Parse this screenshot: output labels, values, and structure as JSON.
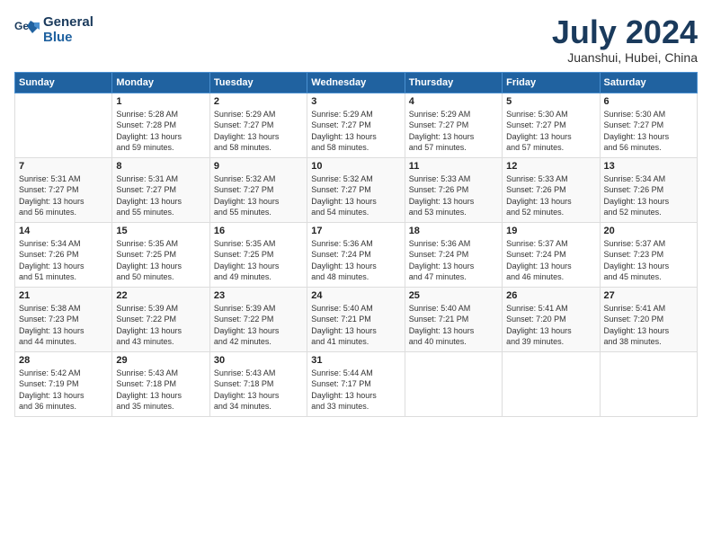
{
  "logo": {
    "line1": "General",
    "line2": "Blue"
  },
  "title": "July 2024",
  "subtitle": "Juanshui, Hubei, China",
  "headers": [
    "Sunday",
    "Monday",
    "Tuesday",
    "Wednesday",
    "Thursday",
    "Friday",
    "Saturday"
  ],
  "weeks": [
    [
      {
        "day": "",
        "sunrise": "",
        "sunset": "",
        "daylight": ""
      },
      {
        "day": "1",
        "sunrise": "5:28 AM",
        "sunset": "7:28 PM",
        "daylight": "13 hours and 59 minutes."
      },
      {
        "day": "2",
        "sunrise": "5:29 AM",
        "sunset": "7:27 PM",
        "daylight": "13 hours and 58 minutes."
      },
      {
        "day": "3",
        "sunrise": "5:29 AM",
        "sunset": "7:27 PM",
        "daylight": "13 hours and 58 minutes."
      },
      {
        "day": "4",
        "sunrise": "5:29 AM",
        "sunset": "7:27 PM",
        "daylight": "13 hours and 57 minutes."
      },
      {
        "day": "5",
        "sunrise": "5:30 AM",
        "sunset": "7:27 PM",
        "daylight": "13 hours and 57 minutes."
      },
      {
        "day": "6",
        "sunrise": "5:30 AM",
        "sunset": "7:27 PM",
        "daylight": "13 hours and 56 minutes."
      }
    ],
    [
      {
        "day": "7",
        "sunrise": "5:31 AM",
        "sunset": "7:27 PM",
        "daylight": "13 hours and 56 minutes."
      },
      {
        "day": "8",
        "sunrise": "5:31 AM",
        "sunset": "7:27 PM",
        "daylight": "13 hours and 55 minutes."
      },
      {
        "day": "9",
        "sunrise": "5:32 AM",
        "sunset": "7:27 PM",
        "daylight": "13 hours and 55 minutes."
      },
      {
        "day": "10",
        "sunrise": "5:32 AM",
        "sunset": "7:27 PM",
        "daylight": "13 hours and 54 minutes."
      },
      {
        "day": "11",
        "sunrise": "5:33 AM",
        "sunset": "7:26 PM",
        "daylight": "13 hours and 53 minutes."
      },
      {
        "day": "12",
        "sunrise": "5:33 AM",
        "sunset": "7:26 PM",
        "daylight": "13 hours and 52 minutes."
      },
      {
        "day": "13",
        "sunrise": "5:34 AM",
        "sunset": "7:26 PM",
        "daylight": "13 hours and 52 minutes."
      }
    ],
    [
      {
        "day": "14",
        "sunrise": "5:34 AM",
        "sunset": "7:26 PM",
        "daylight": "13 hours and 51 minutes."
      },
      {
        "day": "15",
        "sunrise": "5:35 AM",
        "sunset": "7:25 PM",
        "daylight": "13 hours and 50 minutes."
      },
      {
        "day": "16",
        "sunrise": "5:35 AM",
        "sunset": "7:25 PM",
        "daylight": "13 hours and 49 minutes."
      },
      {
        "day": "17",
        "sunrise": "5:36 AM",
        "sunset": "7:24 PM",
        "daylight": "13 hours and 48 minutes."
      },
      {
        "day": "18",
        "sunrise": "5:36 AM",
        "sunset": "7:24 PM",
        "daylight": "13 hours and 47 minutes."
      },
      {
        "day": "19",
        "sunrise": "5:37 AM",
        "sunset": "7:24 PM",
        "daylight": "13 hours and 46 minutes."
      },
      {
        "day": "20",
        "sunrise": "5:37 AM",
        "sunset": "7:23 PM",
        "daylight": "13 hours and 45 minutes."
      }
    ],
    [
      {
        "day": "21",
        "sunrise": "5:38 AM",
        "sunset": "7:23 PM",
        "daylight": "13 hours and 44 minutes."
      },
      {
        "day": "22",
        "sunrise": "5:39 AM",
        "sunset": "7:22 PM",
        "daylight": "13 hours and 43 minutes."
      },
      {
        "day": "23",
        "sunrise": "5:39 AM",
        "sunset": "7:22 PM",
        "daylight": "13 hours and 42 minutes."
      },
      {
        "day": "24",
        "sunrise": "5:40 AM",
        "sunset": "7:21 PM",
        "daylight": "13 hours and 41 minutes."
      },
      {
        "day": "25",
        "sunrise": "5:40 AM",
        "sunset": "7:21 PM",
        "daylight": "13 hours and 40 minutes."
      },
      {
        "day": "26",
        "sunrise": "5:41 AM",
        "sunset": "7:20 PM",
        "daylight": "13 hours and 39 minutes."
      },
      {
        "day": "27",
        "sunrise": "5:41 AM",
        "sunset": "7:20 PM",
        "daylight": "13 hours and 38 minutes."
      }
    ],
    [
      {
        "day": "28",
        "sunrise": "5:42 AM",
        "sunset": "7:19 PM",
        "daylight": "13 hours and 36 minutes."
      },
      {
        "day": "29",
        "sunrise": "5:43 AM",
        "sunset": "7:18 PM",
        "daylight": "13 hours and 35 minutes."
      },
      {
        "day": "30",
        "sunrise": "5:43 AM",
        "sunset": "7:18 PM",
        "daylight": "13 hours and 34 minutes."
      },
      {
        "day": "31",
        "sunrise": "5:44 AM",
        "sunset": "7:17 PM",
        "daylight": "13 hours and 33 minutes."
      },
      {
        "day": "",
        "sunrise": "",
        "sunset": "",
        "daylight": ""
      },
      {
        "day": "",
        "sunrise": "",
        "sunset": "",
        "daylight": ""
      },
      {
        "day": "",
        "sunrise": "",
        "sunset": "",
        "daylight": ""
      }
    ]
  ],
  "labels": {
    "sunrise": "Sunrise:",
    "sunset": "Sunset:",
    "daylight": "Daylight:"
  }
}
